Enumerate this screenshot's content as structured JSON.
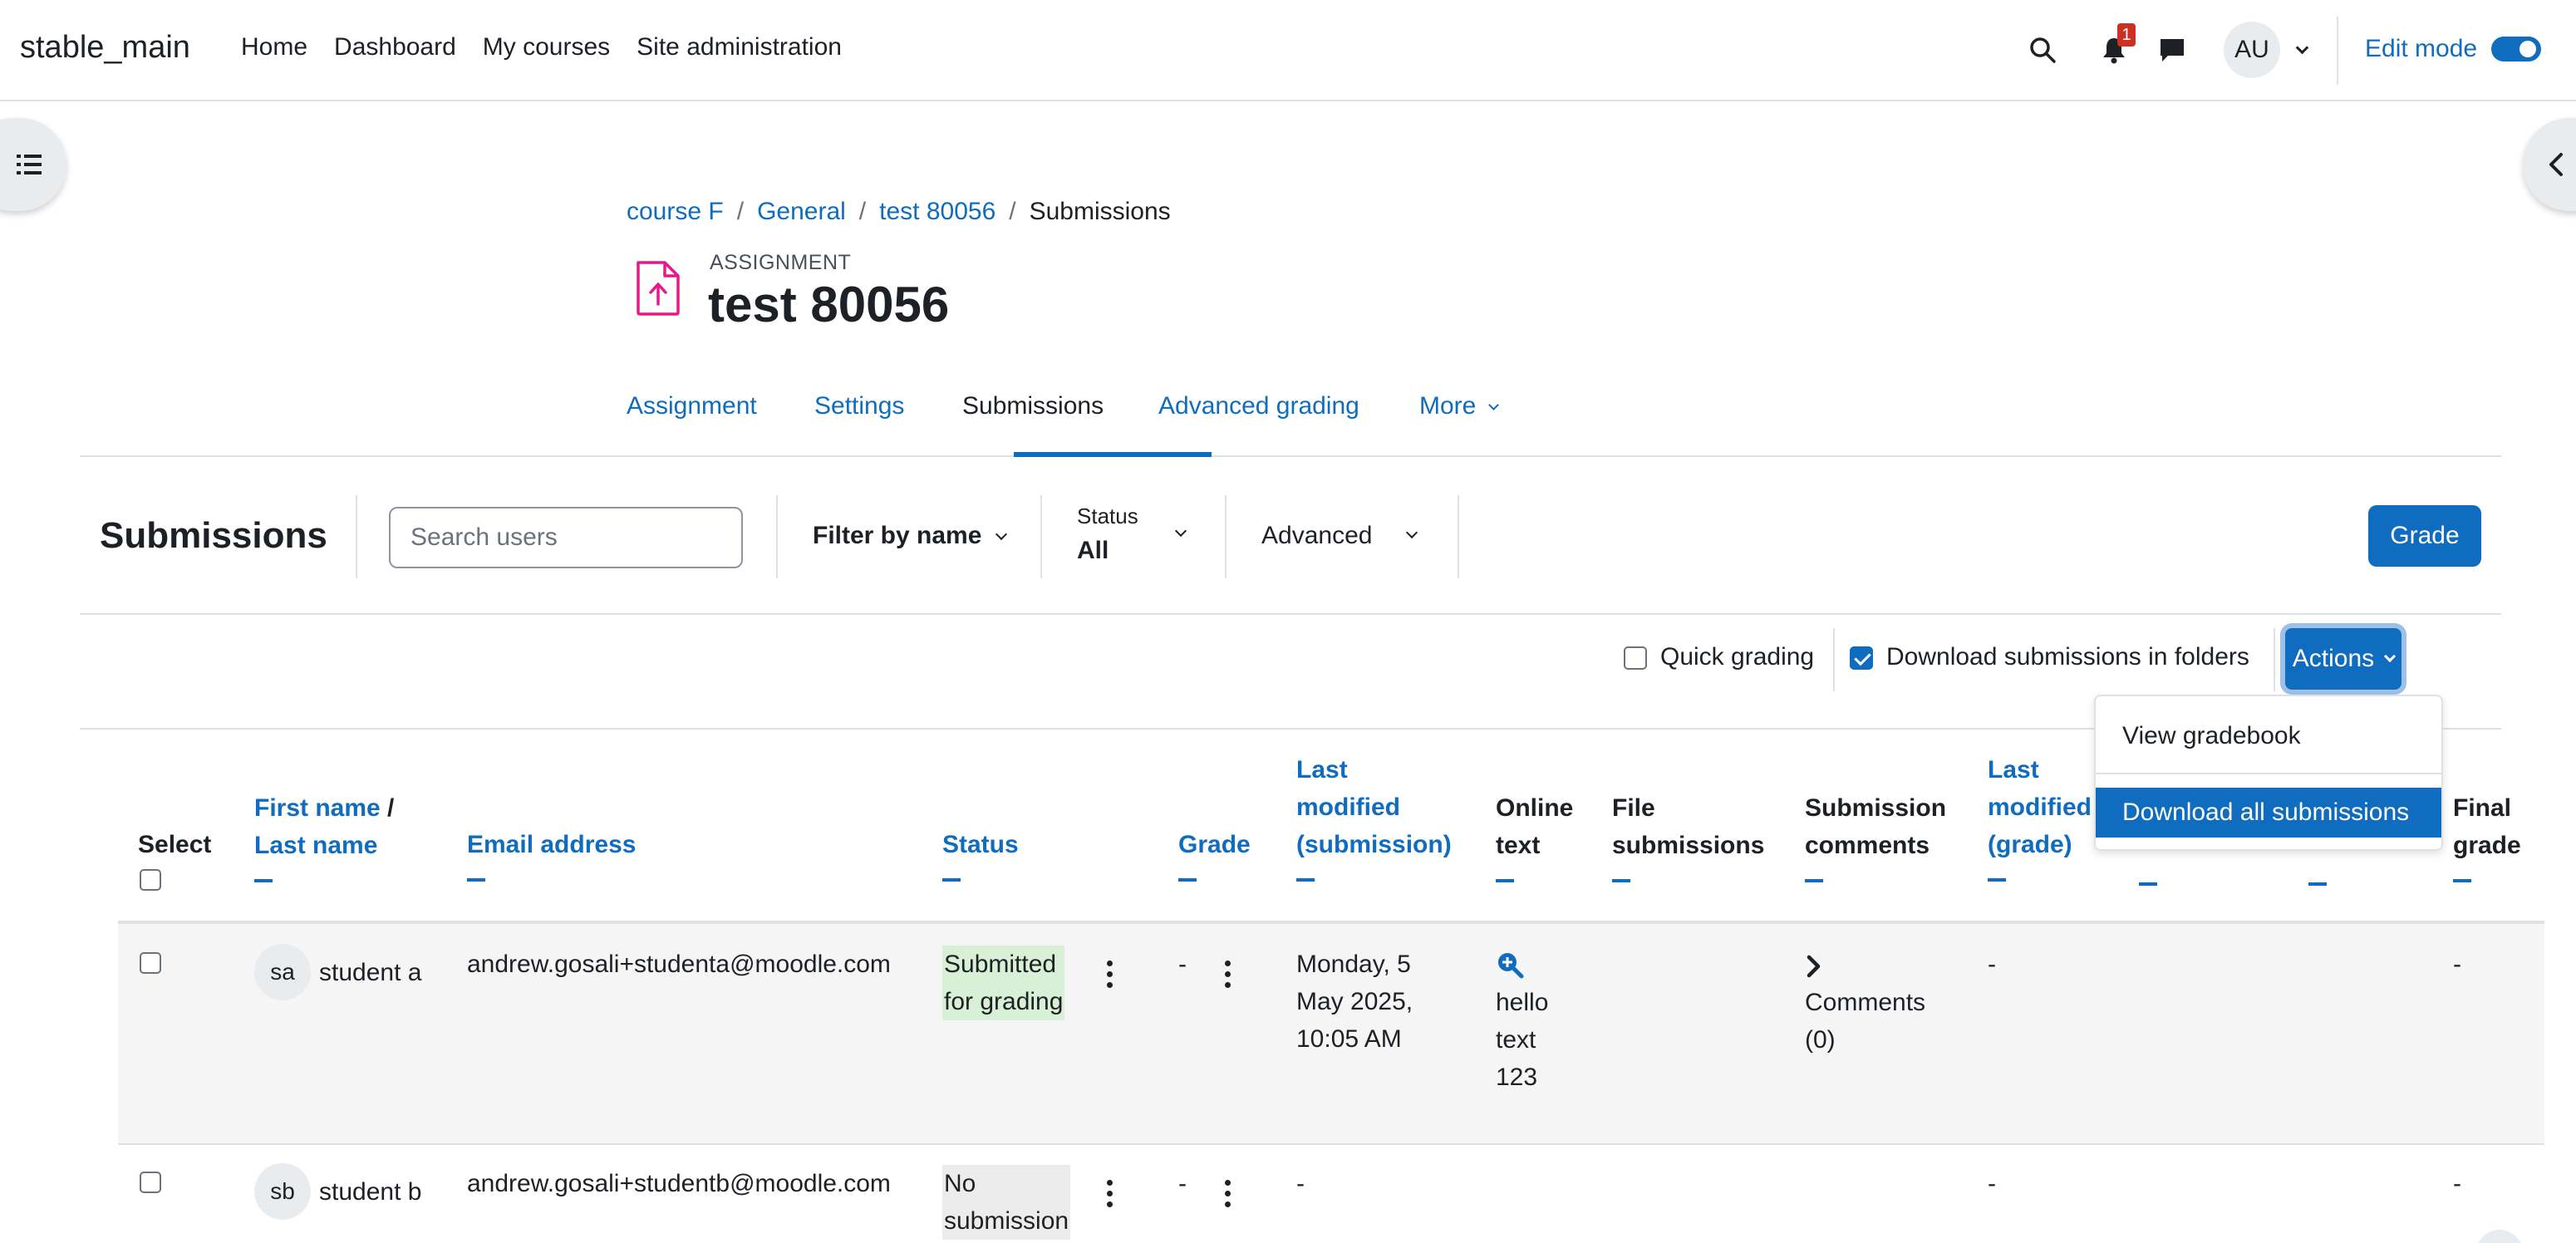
{
  "navbar": {
    "brand": "stable_main",
    "items": [
      "Home",
      "Dashboard",
      "My courses",
      "Site administration"
    ],
    "notification_count": "1",
    "user_initials": "AU",
    "edit_mode_label": "Edit mode",
    "edit_mode_on": true
  },
  "breadcrumb": [
    {
      "label": "course F"
    },
    {
      "label": "General"
    },
    {
      "label": "test 80056"
    },
    {
      "label": "Submissions"
    }
  ],
  "header": {
    "activity_type": "ASSIGNMENT",
    "title": "test 80056"
  },
  "tabs": [
    {
      "label": "Assignment",
      "active": false
    },
    {
      "label": "Settings",
      "active": false
    },
    {
      "label": "Submissions",
      "active": true
    },
    {
      "label": "Advanced grading",
      "active": false
    },
    {
      "label": "More",
      "active": false
    }
  ],
  "filters": {
    "heading": "Submissions",
    "search_placeholder": "Search users",
    "filter_by_name": "Filter by name",
    "status_label": "Status",
    "status_value": "All",
    "advanced_label": "Advanced",
    "grade_button": "Grade"
  },
  "options": {
    "quick_grading": "Quick grading",
    "quick_grading_checked": false,
    "download_in_folders": "Download submissions in folders",
    "download_in_folders_checked": true,
    "actions_button": "Actions"
  },
  "actions_menu": {
    "items": [
      "View gradebook",
      "Download all submissions"
    ],
    "active_index": 1
  },
  "table": {
    "headers": {
      "select": "Select",
      "first_name": "First name",
      "slash": " /",
      "last_name": "Last name",
      "email": "Email address",
      "status": "Status",
      "grade": "Grade",
      "last_modified_sub_1": "Last",
      "last_modified_sub_2": "modified",
      "last_modified_sub_3": "(submission)",
      "online_text_1": "Online",
      "online_text_2": "text",
      "file_sub_1": "File",
      "file_sub_2": "submissions",
      "sub_comments_1": "Submission",
      "sub_comments_2": "comments",
      "last_modified_grade_1": "Last",
      "last_modified_grade_2": "modified",
      "last_modified_grade_3": "(grade)",
      "final_grade_1": "Final",
      "final_grade_2": "grade"
    },
    "rows": [
      {
        "initials": "sa",
        "name": "student a",
        "email": "andrew.gosali+studenta@moodle.com",
        "status_1": "Submitted",
        "status_2": "for grading",
        "grade": "-",
        "modified_1": "Monday, 5",
        "modified_2": "May 2025,",
        "modified_3": "10:05 AM",
        "online_1": "hello",
        "online_2": "text",
        "online_3": "123",
        "comments_1": "Comments",
        "comments_2": "(0)",
        "modified_grade": "-",
        "final_grade": "-"
      },
      {
        "initials": "sb",
        "name": "student b",
        "email": "andrew.gosali+studentb@moodle.com",
        "status_1": "No",
        "status_2": "submission",
        "grade": "-",
        "modified": "-",
        "modified_grade": "-",
        "final_grade": "-"
      }
    ]
  },
  "colors": {
    "accent": "#0f6cbf",
    "submitted_bg": "#d7f0d6",
    "no_submission_bg": "#ececec",
    "notification_badge": "#ca3120"
  }
}
